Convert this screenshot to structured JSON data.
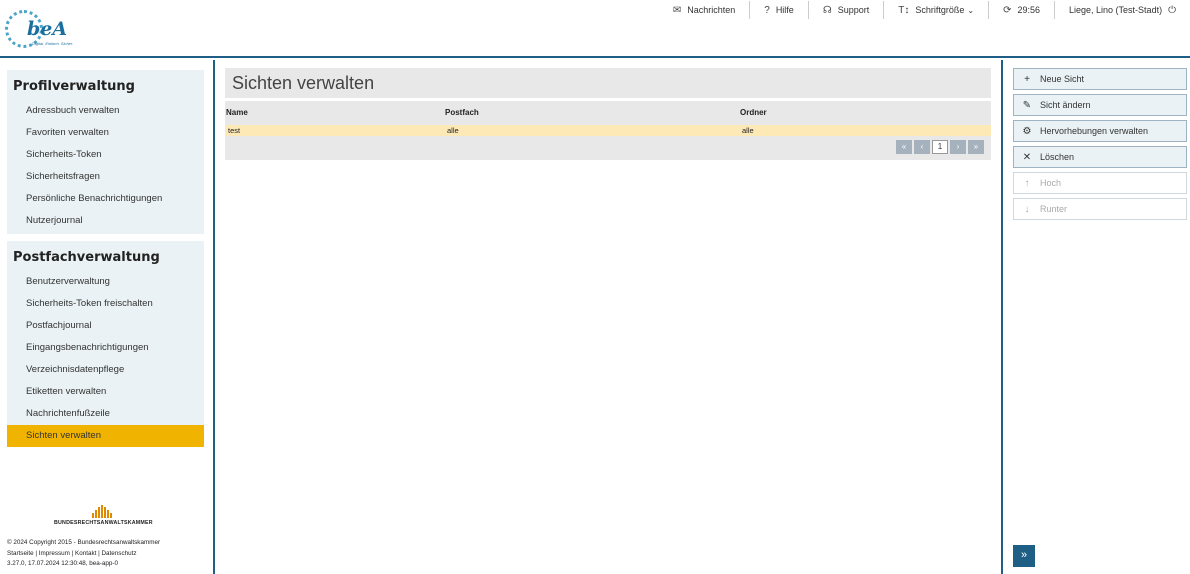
{
  "header": {
    "logo_text": "beA",
    "logo_tagline": "Digital. Einfach. Sicher.",
    "nav": [
      {
        "icon": "envelope-icon",
        "glyph": "✉",
        "label": "Nachrichten"
      },
      {
        "icon": "help-icon",
        "glyph": "?",
        "label": "Hilfe"
      },
      {
        "icon": "headset-icon",
        "glyph": "☊",
        "label": "Support"
      },
      {
        "icon": "font-size-icon",
        "glyph": "T↕",
        "label": "Schriftgröße"
      },
      {
        "icon": "refresh-icon",
        "glyph": "⟳",
        "label": "29:56"
      },
      {
        "icon": "power-icon",
        "glyph": "⏻",
        "label": "Liege, Lino (Test-Stadt)"
      }
    ],
    "dropdown_caret": "⌄"
  },
  "sidebar": {
    "profile": {
      "title": "Profilverwaltung",
      "items": [
        "Adressbuch verwalten",
        "Favoriten verwalten",
        "Sicherheits-Token",
        "Sicherheitsfragen",
        "Persönliche Benachrichtigungen",
        "Nutzerjournal"
      ]
    },
    "mailbox": {
      "title": "Postfachverwaltung",
      "items": [
        "Benutzerverwaltung",
        "Sicherheits-Token freischalten",
        "Postfachjournal",
        "Eingangsbenachrichtigungen",
        "Verzeichnisdatenpflege",
        "Etiketten verwalten",
        "Nachrichtenfußzeile",
        "Sichten verwalten"
      ],
      "active_index": 7
    }
  },
  "footer": {
    "brand": "BUNDESRECHTSANWALTSKAMMER",
    "copyright": "© 2024 Copyright 2015 - Bundesrechtsanwaltskammer",
    "links": "Startseite | Impressum | Kontakt | Datenschutz",
    "version": "3.27.0, 17.07.2024 12:30:48, bea-app-0"
  },
  "main": {
    "title": "Sichten verwalten",
    "columns": [
      "Name",
      "Postfach",
      "Ordner"
    ],
    "rows": [
      [
        "test",
        "alle",
        "alle"
      ]
    ],
    "pager": {
      "first": "«",
      "prev": "‹",
      "page": "1",
      "next": "›",
      "last": "»"
    }
  },
  "actions": [
    {
      "icon": "plus-icon",
      "glyph": "+",
      "label": "Neue Sicht",
      "enabled": true
    },
    {
      "icon": "pencil-icon",
      "glyph": "✎",
      "label": "Sicht ändern",
      "enabled": true
    },
    {
      "icon": "gear-icon",
      "glyph": "⚙",
      "label": "Hervorhebungen verwalten",
      "enabled": true
    },
    {
      "icon": "close-icon",
      "glyph": "✕",
      "label": "Löschen",
      "enabled": true
    },
    {
      "icon": "arrow-up-icon",
      "glyph": "↑",
      "label": "Hoch",
      "enabled": false
    },
    {
      "icon": "arrow-down-icon",
      "glyph": "↓",
      "label": "Runter",
      "enabled": false
    }
  ],
  "collapse_glyph": "»",
  "colors": {
    "accent": "#1f5f86",
    "active": "#f0b400",
    "row_highlight": "#fde9b5"
  }
}
